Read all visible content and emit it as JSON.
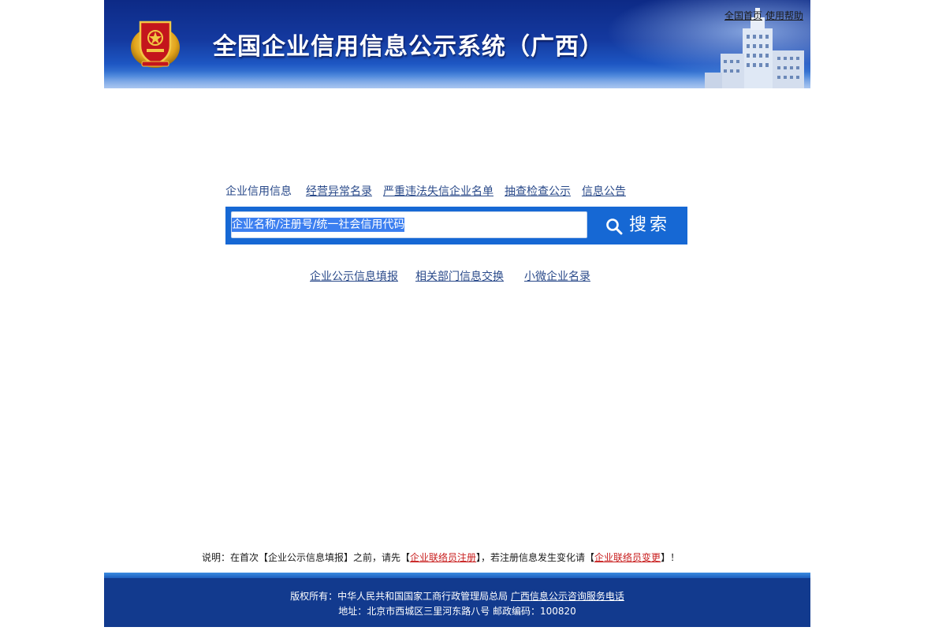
{
  "header": {
    "title": "全国企业信用信息公示系统（广西）",
    "top_links": [
      "全国首页",
      "使用帮助"
    ]
  },
  "nav": {
    "items": [
      "企业信用信息",
      "经营异常名录",
      "严重违法失信企业名单",
      "抽查检查公示",
      "信息公告"
    ]
  },
  "search": {
    "input_value": "企业名称/注册号/统一社会信用代码",
    "button_label": "搜索"
  },
  "sub_links": [
    "企业公示信息填报",
    "相关部门信息交换",
    "小微企业名录"
  ],
  "note": {
    "prefix": "说明：在首次【企业公示信息填报】之前，请先【",
    "link1": "企业联络员注册",
    "middle": "】，若注册信息发生变化请【",
    "link2": "企业联络员变更",
    "suffix": "】！"
  },
  "footer": {
    "copyright_prefix": "版权所有：中华人民共和国国家工商行政管理局总局",
    "hotline_link": "广西信息公示咨询服务电话",
    "address": "地址：北京市西城区三里河东路八号 邮政编码：100820"
  },
  "colors": {
    "header_blue": "#14399f",
    "search_blue": "#1668d4",
    "footer_blue": "#123a8e",
    "link_blue": "#2a4a8a",
    "note_red": "#c81e1e"
  },
  "icons": {
    "emblem": "national-emblem-icon",
    "search": "magnifier-icon",
    "building": "building-illustration"
  }
}
